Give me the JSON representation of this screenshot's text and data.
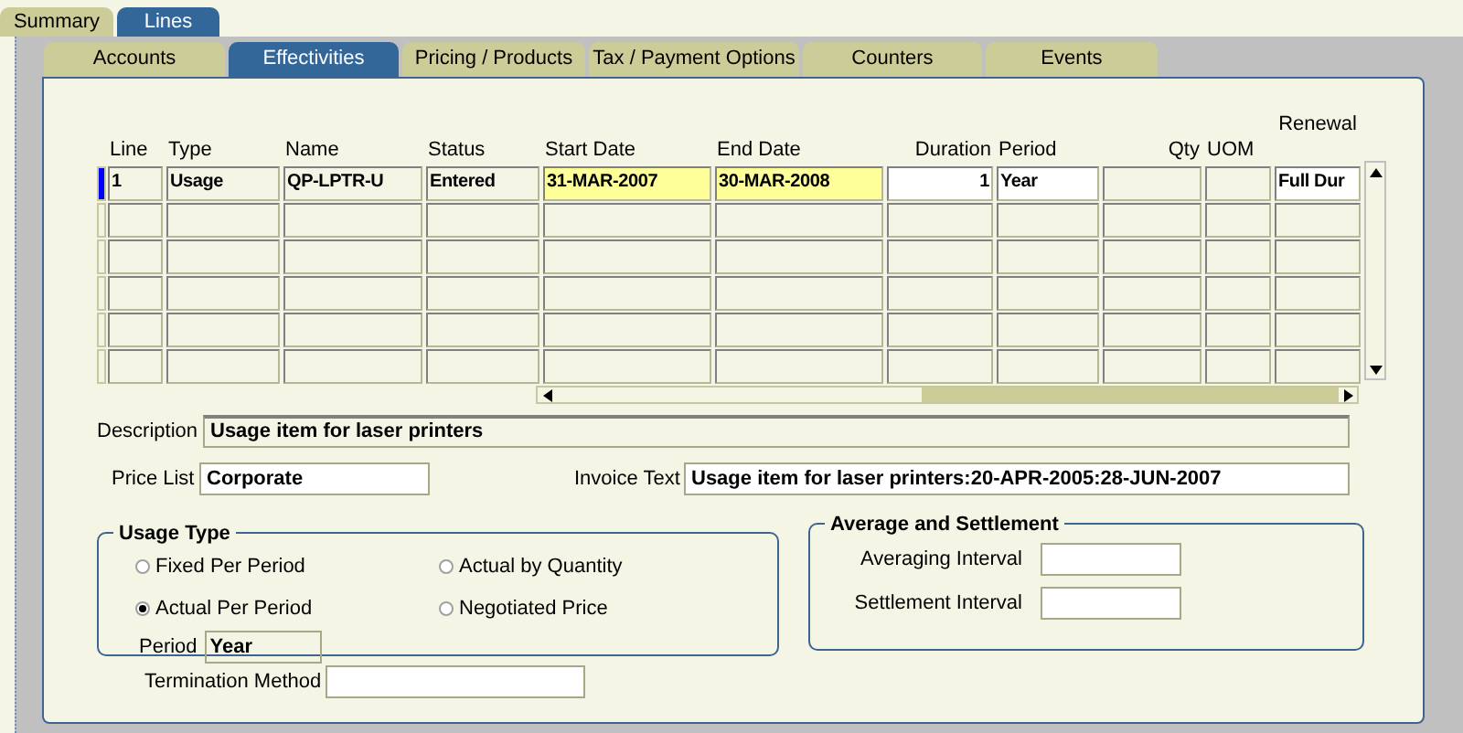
{
  "tabs": [
    {
      "label": "Summary",
      "selected": false
    },
    {
      "label": "Lines",
      "selected": true
    }
  ],
  "subtabs": [
    {
      "label": "Accounts",
      "selected": false
    },
    {
      "label": "Effectivities",
      "selected": true
    },
    {
      "label": "Pricing / Products",
      "selected": false
    },
    {
      "label": "Tax / Payment Options",
      "selected": false
    },
    {
      "label": "Counters",
      "selected": false
    },
    {
      "label": "Events",
      "selected": false
    }
  ],
  "table": {
    "columns": [
      "Line",
      "Type",
      "Name",
      "Status",
      "Start Date",
      "End Date",
      "Duration",
      "Period",
      "Qty",
      "UOM",
      "Renewal"
    ],
    "rows": [
      {
        "selected": true,
        "cells": [
          {
            "text": "1",
            "kind": "readonly"
          },
          {
            "text": "Usage",
            "kind": "readonly"
          },
          {
            "text": "QP-LPTR-U",
            "kind": "readonly"
          },
          {
            "text": "Entered",
            "kind": "readonly"
          },
          {
            "text": "31-MAR-2007",
            "kind": "required"
          },
          {
            "text": "30-MAR-2008",
            "kind": "required"
          },
          {
            "text": "1",
            "kind": "editable"
          },
          {
            "text": "Year",
            "kind": "editable"
          },
          {
            "kind": "readonly"
          },
          {
            "kind": "readonly"
          },
          {
            "text": "Full Dur",
            "kind": "editable"
          }
        ]
      }
    ]
  },
  "description": {
    "label": "Description",
    "value": "Usage item for laser printers"
  },
  "price_list": {
    "label": "Price List",
    "value": "Corporate"
  },
  "invoice_text": {
    "label": "Invoice Text",
    "value": "Usage item for laser printers:20-APR-2005:28-JUN-2007"
  },
  "usage_type": {
    "title": "Usage Type",
    "options": [
      {
        "label": "Fixed Per Period",
        "selected": false
      },
      {
        "label": "Actual by Quantity",
        "selected": false
      },
      {
        "label": "Actual Per Period",
        "selected": true
      },
      {
        "label": "Negotiated Price",
        "selected": false
      }
    ],
    "period": {
      "label": "Period",
      "value": "Year"
    }
  },
  "average_settlement": {
    "title": "Average and Settlement",
    "fields": [
      {
        "label": "Averaging Interval"
      },
      {
        "label": "Settlement Interval"
      }
    ]
  },
  "termination": {
    "label": "Termination Method"
  }
}
